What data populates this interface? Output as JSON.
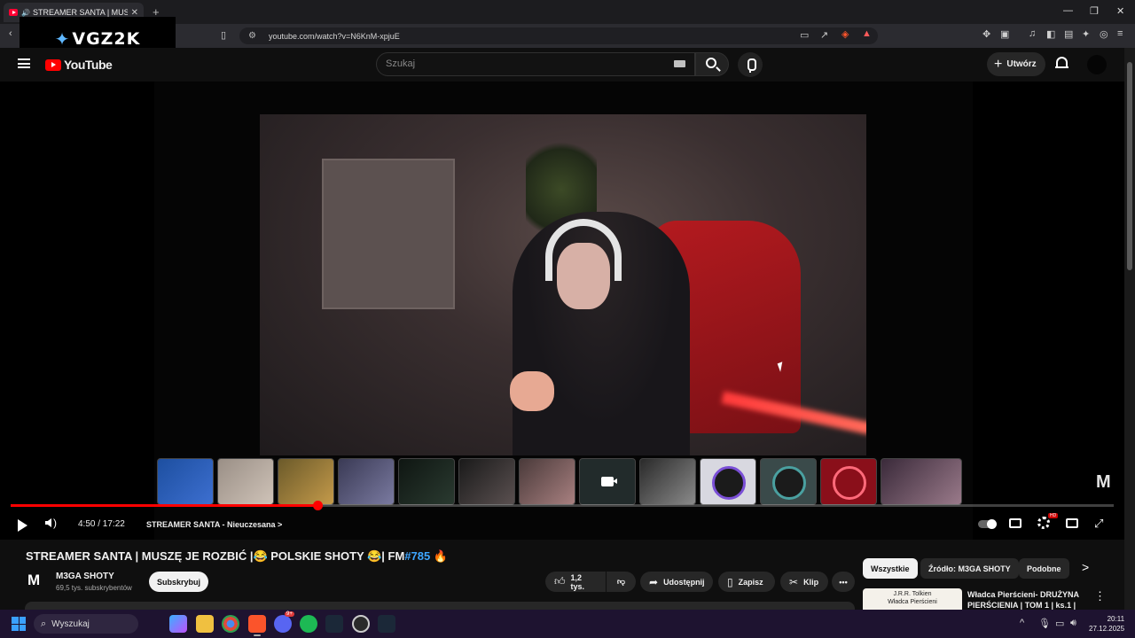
{
  "browser": {
    "tab_title": "STREAMER SANTA | MUSZĘ JE ROZBIĆ",
    "tab_close": "✕",
    "new_tab": "+",
    "url": "youtube.com/watch?v=N6KnM-xpjuE",
    "window_controls": [
      "—",
      "❐",
      "✕"
    ]
  },
  "overlay_logo": {
    "text": "VGZ2K"
  },
  "youtube": {
    "logo_text": "YouTube",
    "search_placeholder": "Szukaj",
    "create_label": "Utwórz"
  },
  "player": {
    "time": "4:50 / 17:22",
    "chapter": "STREAMER SANTA - Nieuczesana",
    "chapter_arrow": ">",
    "progress_fraction": 0.278,
    "watermark": "M",
    "settings_badge": "HD"
  },
  "video": {
    "title_main": "STREAMER SANTA | MUSZĘ JE ROZBIĆ |😂 POLSKIE SHOTY 😂| FM",
    "title_tag": "#785",
    "title_emoji": "🔥",
    "channel_logo": "M",
    "channel_name": "M3GA SHOTY",
    "subscribers": "69,5 tys. subskrybentów",
    "subscribe_label": "Subskrybuj",
    "likes": "1,2 tys.",
    "share_label": "Udostępnij",
    "save_label": "Zapisz",
    "clip_label": "Klip",
    "more_label": "•••"
  },
  "recommendations": {
    "chips": [
      "Wszystkie",
      "Źródło: M3GA SHOTY",
      "Podobne"
    ],
    "next_arrow": ">",
    "item_thumb_text": "J.R.R. Tolkien\nWładca Pierścieni",
    "item_title": "Władca Pierścieni- DRUŻYNA PIERŚCIENIA | TOM 1 | ks.1 |",
    "item_more": "⋮"
  },
  "taskbar": {
    "search_label": "Wyszukaj",
    "discord_badge": "9+",
    "time": "20:11",
    "date": "27.12.2025"
  },
  "colors": {
    "accent": "#ff0000",
    "hashtag": "#3ea6ff",
    "taskbar": "#1e1330"
  }
}
